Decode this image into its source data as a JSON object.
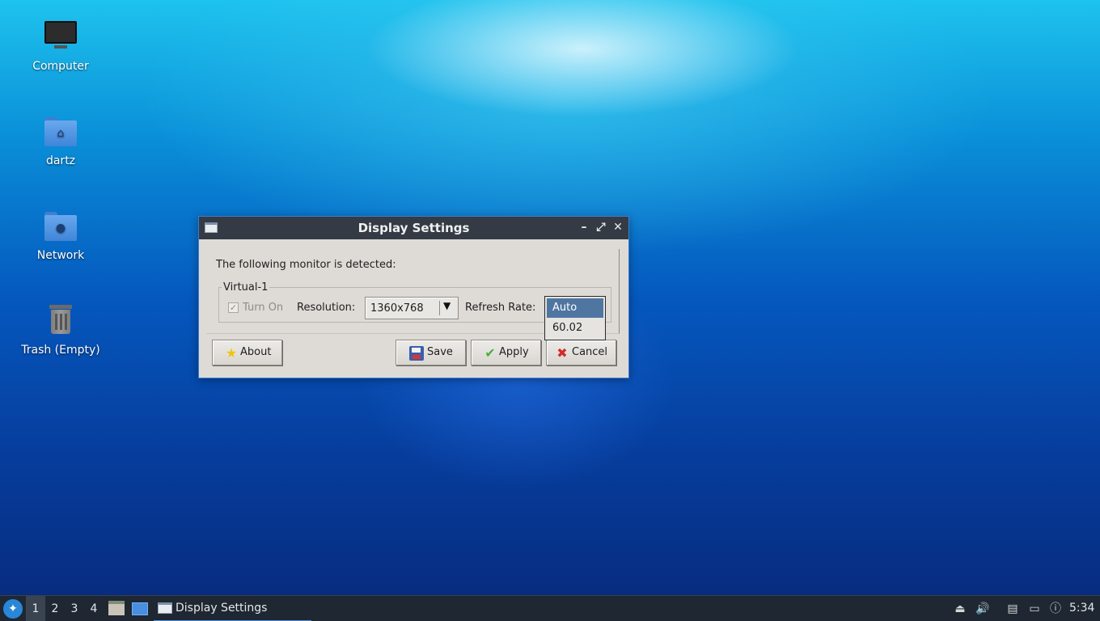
{
  "desktop": {
    "icons": [
      {
        "label": "Computer",
        "icon": "computer-icon"
      },
      {
        "label": "dartz",
        "icon": "home-folder-icon"
      },
      {
        "label": "Network",
        "icon": "network-folder-icon"
      },
      {
        "label": "Trash (Empty)",
        "icon": "trash-icon"
      }
    ]
  },
  "dialog": {
    "title": "Display Settings",
    "detected_text": "The following monitor is detected:",
    "monitor_name": "Virtual-1",
    "turn_on_label": "Turn On",
    "turn_on_checked": true,
    "resolution_label": "Resolution:",
    "resolution_value": "1360x768",
    "refresh_label": "Refresh Rate:",
    "refresh_options": [
      "Auto",
      "60.02"
    ],
    "refresh_selected": "Auto",
    "buttons": {
      "about": "About",
      "save": "Save",
      "apply": "Apply",
      "cancel": "Cancel"
    }
  },
  "taskbar": {
    "desktops": [
      "1",
      "2",
      "3",
      "4"
    ],
    "active_desktop": "1",
    "task_title": "Display Settings",
    "clock": "5:34"
  },
  "colors": {
    "titlebar": "#343b45",
    "dialog_bg": "#dedbd6",
    "selection": "#4f76a1",
    "taskbar": "#1e2732"
  }
}
